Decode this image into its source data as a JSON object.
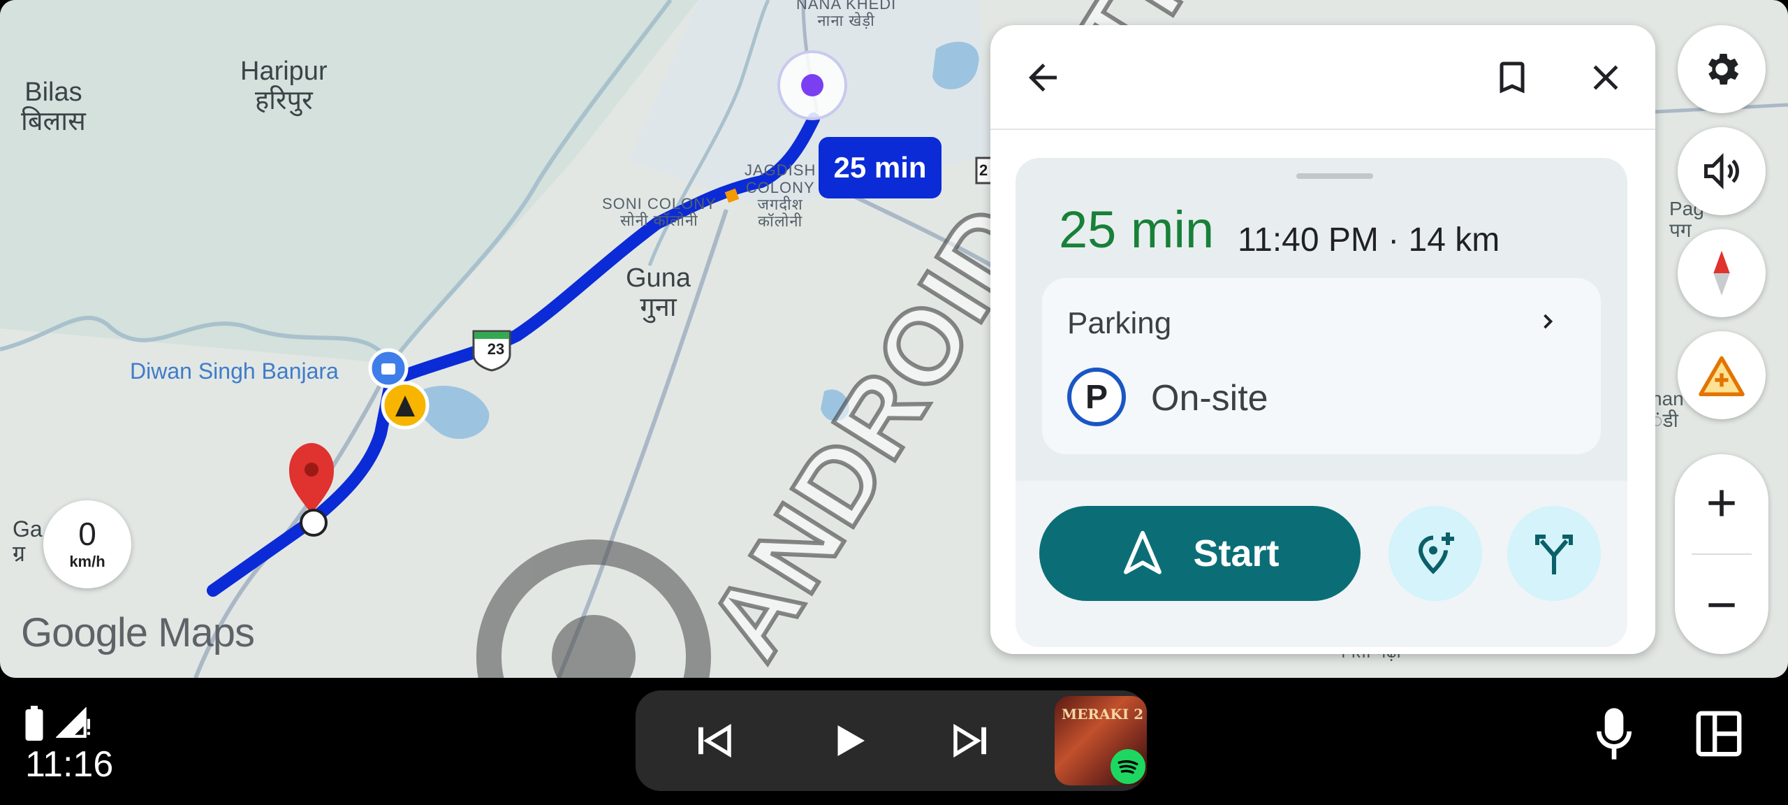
{
  "map": {
    "labels": {
      "bilas_en": "Bilas",
      "bilas_hi": "बिलास",
      "haripur_en": "Haripur",
      "haripur_hi": "हरिपुर",
      "nana_khedi_en": "NANA KHEDI",
      "nana_khedi_hi": "नाना खेड़ी",
      "jagdish_en": "JAGDISH\nCOLONY",
      "jagdish_hi": "जगदीश\nकॉलोनी",
      "soni_en": "SONI COLONY",
      "soni_hi": "सोनी कॉलोनी",
      "guna_en": "Guna",
      "guna_hi": "गुना",
      "diwan": "Diwan Singh Banjara",
      "route_23": "23",
      "route_edge": "2",
      "pag_en": "Pag",
      "pag_hi": "पग",
      "han_en": "han",
      "han_hi": "ंडी",
      "nita": "निता गढ़ा",
      "ga_en": "Ga",
      "ga_hi": "ग्र"
    },
    "route_time_badge": "25 min",
    "speed": {
      "value": "0",
      "unit": "km/h"
    },
    "logo": {
      "google": "Google",
      "maps": "Maps"
    },
    "watermark": "ANDROID AUTHORITY"
  },
  "panel": {
    "eta": "25 min",
    "arrival_info": "11:40 PM · 14 km",
    "parking": {
      "label": "Parking",
      "icon_letter": "P",
      "value": "On-site"
    },
    "start_label": "Start"
  },
  "status": {
    "time": "11:16"
  },
  "media": {
    "album_title": "MERAKI 2"
  },
  "colors": {
    "route": "#0b2bd6",
    "eta_green": "#188038",
    "start_teal": "#0b6e77",
    "action_bg": "#d4f3fa"
  }
}
